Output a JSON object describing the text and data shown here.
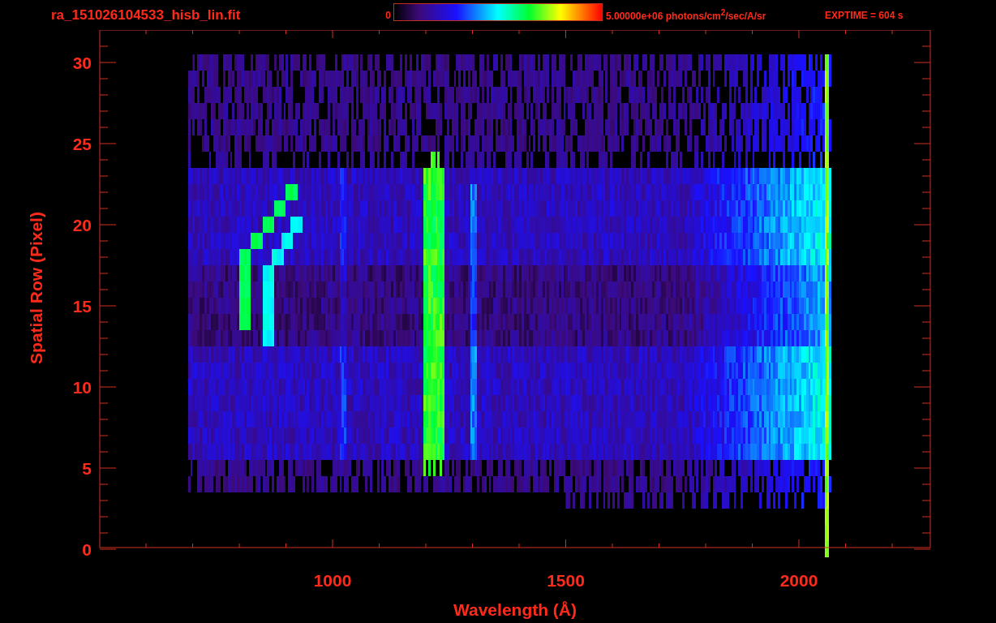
{
  "title": "ra_151026104533_hisb_lin.fit",
  "colorbar": {
    "min_label": "0",
    "max_label": "5.00000e+06 photons/cm$^{2}$/sec/A/sr"
  },
  "exposure": "EXPTIME = 604 s",
  "x_axis": {
    "label": "Wavelength (Å)",
    "ticks": [
      "1000",
      "1500",
      "2000"
    ]
  },
  "y_axis": {
    "label": "Spatial Row (Pixel)",
    "ticks": [
      "30",
      "25",
      "20",
      "15",
      "10",
      "5",
      "0"
    ]
  }
}
